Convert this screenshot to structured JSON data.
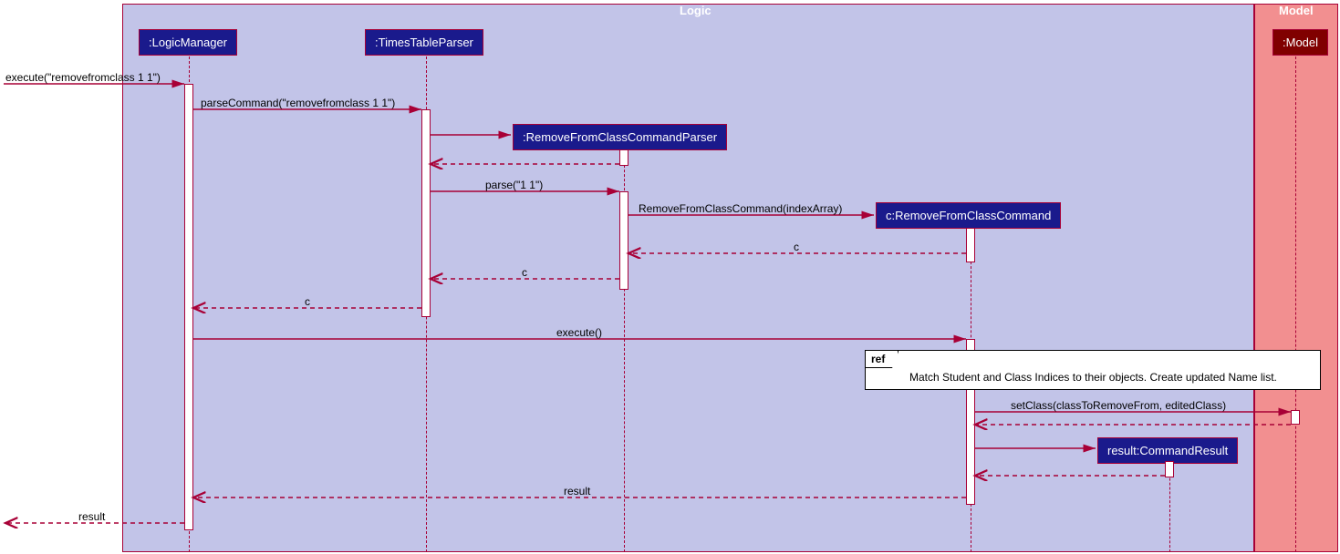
{
  "frames": {
    "logic": "Logic",
    "model": "Model"
  },
  "participants": {
    "logicManager": ":LogicManager",
    "timesTableParser": ":TimesTableParser",
    "removeParser": ":RemoveFromClassCommandParser",
    "removeCmd": "c:RemoveFromClassCommand",
    "model": ":Model",
    "cmdResult": "result:CommandResult"
  },
  "messages": {
    "m1": "execute(\"removefromclass 1 1\")",
    "m2": "parseCommand(\"removefromclass 1 1\")",
    "m3": "parse(\"1 1\")",
    "m4": "RemoveFromClassCommand(indexArray)",
    "m5": "c",
    "m6": "c",
    "m7": "c",
    "m8": "execute()",
    "m9": "setClass(classToRemoveFrom, editedClass)",
    "m10": "result",
    "m11": "result"
  },
  "ref": {
    "label": "ref",
    "text": "Match Student and Class Indices to their objects. Create updated Name list."
  },
  "chart_data": {
    "type": "sequence-diagram",
    "frames": [
      {
        "name": "Logic",
        "contains": [
          ":LogicManager",
          ":TimesTableParser",
          ":RemoveFromClassCommandParser",
          "c:RemoveFromClassCommand",
          "result:CommandResult"
        ]
      },
      {
        "name": "Model",
        "contains": [
          ":Model"
        ]
      }
    ],
    "participants": [
      {
        "id": "LM",
        "label": ":LogicManager",
        "created_at_start": true
      },
      {
        "id": "TTP",
        "label": ":TimesTableParser",
        "created_at_start": true
      },
      {
        "id": "RFCCP",
        "label": ":RemoveFromClassCommandParser",
        "created_at_start": false
      },
      {
        "id": "RFCC",
        "label": "c:RemoveFromClassCommand",
        "created_at_start": false
      },
      {
        "id": "M",
        "label": ":Model",
        "created_at_start": true
      },
      {
        "id": "CR",
        "label": "result:CommandResult",
        "created_at_start": false
      }
    ],
    "messages": [
      {
        "from": "caller",
        "to": "LM",
        "label": "execute(\"removefromclass 1 1\")",
        "type": "sync"
      },
      {
        "from": "LM",
        "to": "TTP",
        "label": "parseCommand(\"removefromclass 1 1\")",
        "type": "sync"
      },
      {
        "from": "TTP",
        "to": "RFCCP",
        "label": "",
        "type": "create"
      },
      {
        "from": "RFCCP",
        "to": "TTP",
        "label": "",
        "type": "return"
      },
      {
        "from": "TTP",
        "to": "RFCCP",
        "label": "parse(\"1 1\")",
        "type": "sync"
      },
      {
        "from": "RFCCP",
        "to": "RFCC",
        "label": "RemoveFromClassCommand(indexArray)",
        "type": "create"
      },
      {
        "from": "RFCC",
        "to": "RFCCP",
        "label": "c",
        "type": "return"
      },
      {
        "from": "RFCCP",
        "to": "TTP",
        "label": "c",
        "type": "return"
      },
      {
        "from": "TTP",
        "to": "LM",
        "label": "c",
        "type": "return"
      },
      {
        "from": "LM",
        "to": "RFCC",
        "label": "execute()",
        "type": "sync"
      },
      {
        "ref": "Match Student and Class Indices to their objects. Create updated Name list."
      },
      {
        "from": "RFCC",
        "to": "M",
        "label": "setClass(classToRemoveFrom, editedClass)",
        "type": "sync"
      },
      {
        "from": "M",
        "to": "RFCC",
        "label": "",
        "type": "return"
      },
      {
        "from": "RFCC",
        "to": "CR",
        "label": "",
        "type": "create"
      },
      {
        "from": "CR",
        "to": "RFCC",
        "label": "",
        "type": "return"
      },
      {
        "from": "RFCC",
        "to": "LM",
        "label": "result",
        "type": "return"
      },
      {
        "from": "LM",
        "to": "caller",
        "label": "result",
        "type": "return"
      }
    ]
  }
}
